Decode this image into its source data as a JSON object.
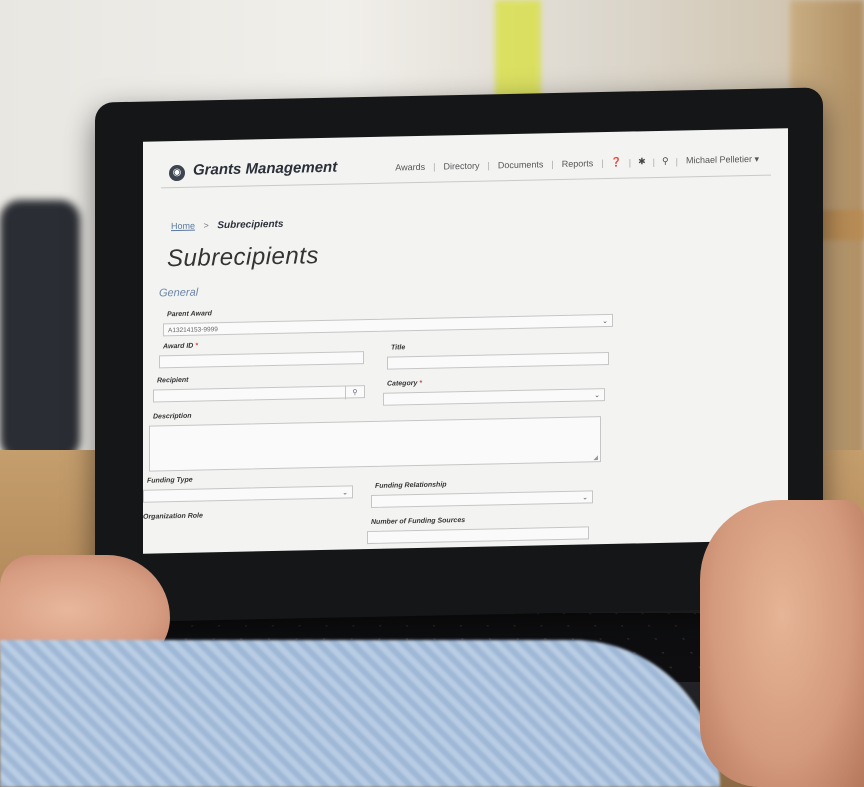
{
  "app": {
    "title": "Grants Management"
  },
  "nav": {
    "items": [
      "Awards",
      "Directory",
      "Documents",
      "Reports"
    ],
    "icons": [
      "help-icon",
      "gear-icon",
      "search-icon"
    ],
    "user": "Michael Pelletier ▾"
  },
  "breadcrumb": {
    "home": "Home",
    "separator": ">",
    "current": "Subrecipients"
  },
  "page": {
    "title": "Subrecipients",
    "section": "General"
  },
  "form": {
    "parent_award": {
      "label": "Parent Award",
      "value": "A13214153-9999"
    },
    "award_id": {
      "label": "Award ID",
      "required": "*",
      "value": ""
    },
    "title": {
      "label": "Title",
      "value": ""
    },
    "recipient": {
      "label": "Recipient",
      "value": ""
    },
    "category": {
      "label": "Category",
      "required": "*",
      "value": ""
    },
    "description": {
      "label": "Description",
      "value": ""
    },
    "funding_type": {
      "label": "Funding Type",
      "value": ""
    },
    "funding_relationship": {
      "label": "Funding Relationship",
      "value": ""
    },
    "organization_role": {
      "label": "Organization Role"
    },
    "number_of_funding_sources": {
      "label": "Number of Funding Sources"
    }
  },
  "colors": {
    "accent": "#6a86a8",
    "link": "#5a7aa0",
    "text": "#2a2f38"
  }
}
